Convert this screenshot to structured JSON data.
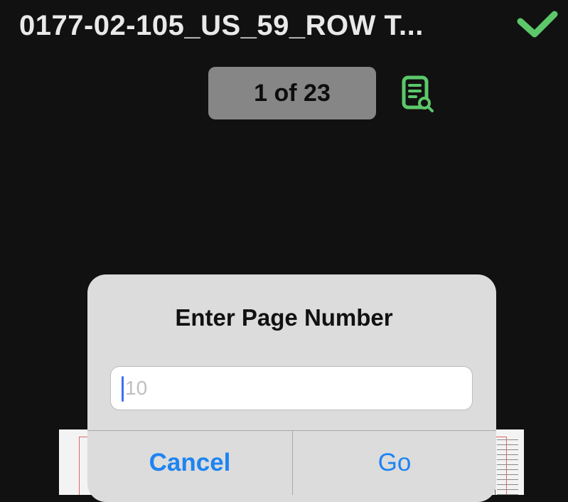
{
  "header": {
    "document_title": "0177-02-105_US_59_ROW T...",
    "done_icon": "checkmark-icon",
    "accent_color": "#5cc86a"
  },
  "page_indicator": {
    "label": "1 of 23"
  },
  "toolbar": {
    "document_search_icon": "document-search-icon"
  },
  "dialog": {
    "title": "Enter Page Number",
    "input_value": "",
    "input_placeholder": "10",
    "cancel_label": "Cancel",
    "go_label": "Go",
    "button_color": "#1e84f2"
  }
}
